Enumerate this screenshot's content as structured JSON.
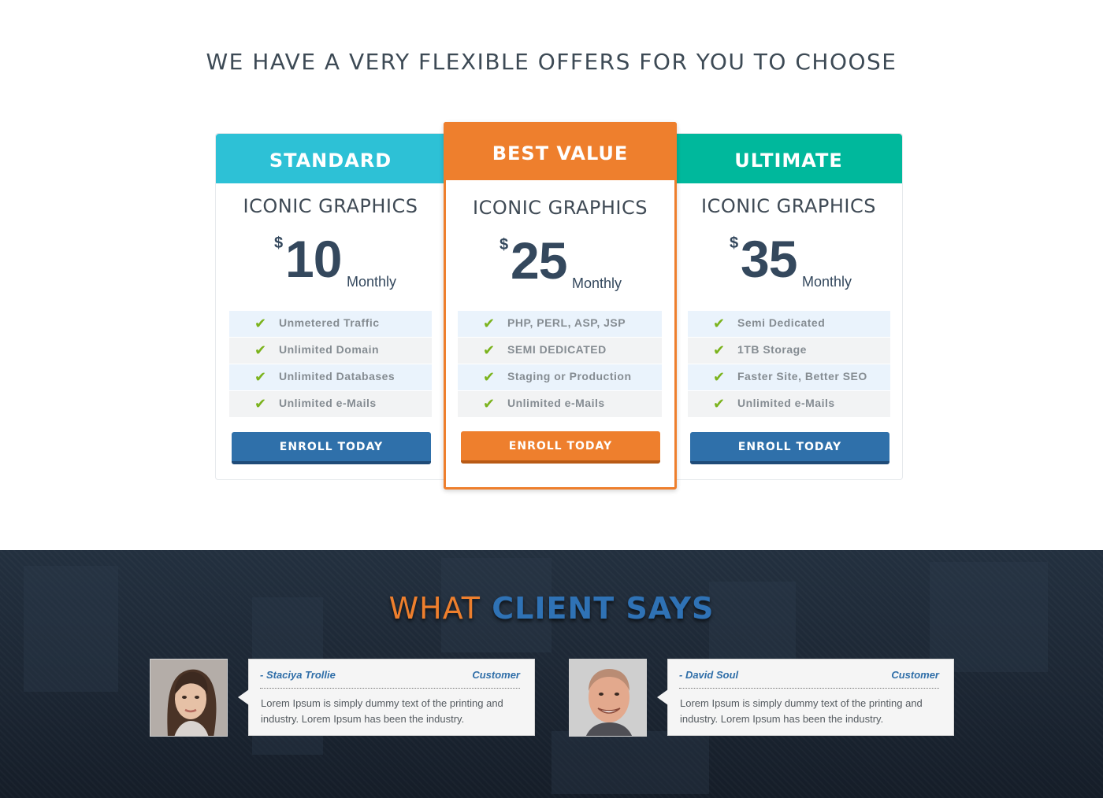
{
  "pricing": {
    "title": "WE HAVE A VERY FLEXIBLE OFFERS FOR YOU TO CHOOSE",
    "plans": [
      {
        "header": "STANDARD",
        "name": "ICONIC GRAPHICS",
        "currency": "$",
        "price": "10",
        "period": "Monthly",
        "features": [
          "Unmetered Traffic",
          "Unlimited Domain",
          "Unlimited Databases",
          "Unlimited e-Mails"
        ],
        "button": "ENROLL TODAY",
        "color": "#2dc1d6"
      },
      {
        "header": "BEST VALUE",
        "name": "ICONIC GRAPHICS",
        "currency": "$",
        "price": "25",
        "period": "Monthly",
        "features": [
          "PHP, PERL, ASP, JSP",
          "SEMI DEDICATED",
          "Staging or Production",
          "Unlimited e-Mails"
        ],
        "button": "ENROLL TODAY",
        "color": "#ee7f2d"
      },
      {
        "header": "ULTIMATE",
        "name": "ICONIC GRAPHICS",
        "currency": "$",
        "price": "35",
        "period": "Monthly",
        "features": [
          "Semi Dedicated",
          "1TB Storage",
          "Faster Site, Better SEO",
          "Unlimited e-Mails"
        ],
        "button": "ENROLL TODAY",
        "color": "#00b89c"
      }
    ]
  },
  "testimonials": {
    "title_part1": "WHAT",
    "title_part2": "CLIENT SAYS",
    "items": [
      {
        "name": "- Staciya Trollie",
        "role": "Customer",
        "text": "Lorem Ipsum is simply dummy text of the printing and industry. Lorem Ipsum has been the industry.",
        "avatar_icon": "woman-portrait-icon"
      },
      {
        "name": "- David Soul",
        "role": "Customer",
        "text": "Lorem Ipsum is simply dummy text of the printing and industry. Lorem Ipsum has been the industry.",
        "avatar_icon": "man-portrait-icon"
      }
    ]
  },
  "colors": {
    "accent_orange": "#ee7f2d",
    "accent_blue": "#2f70aa",
    "check_green": "#7bb31d",
    "dark_bg": "#1c2633"
  }
}
